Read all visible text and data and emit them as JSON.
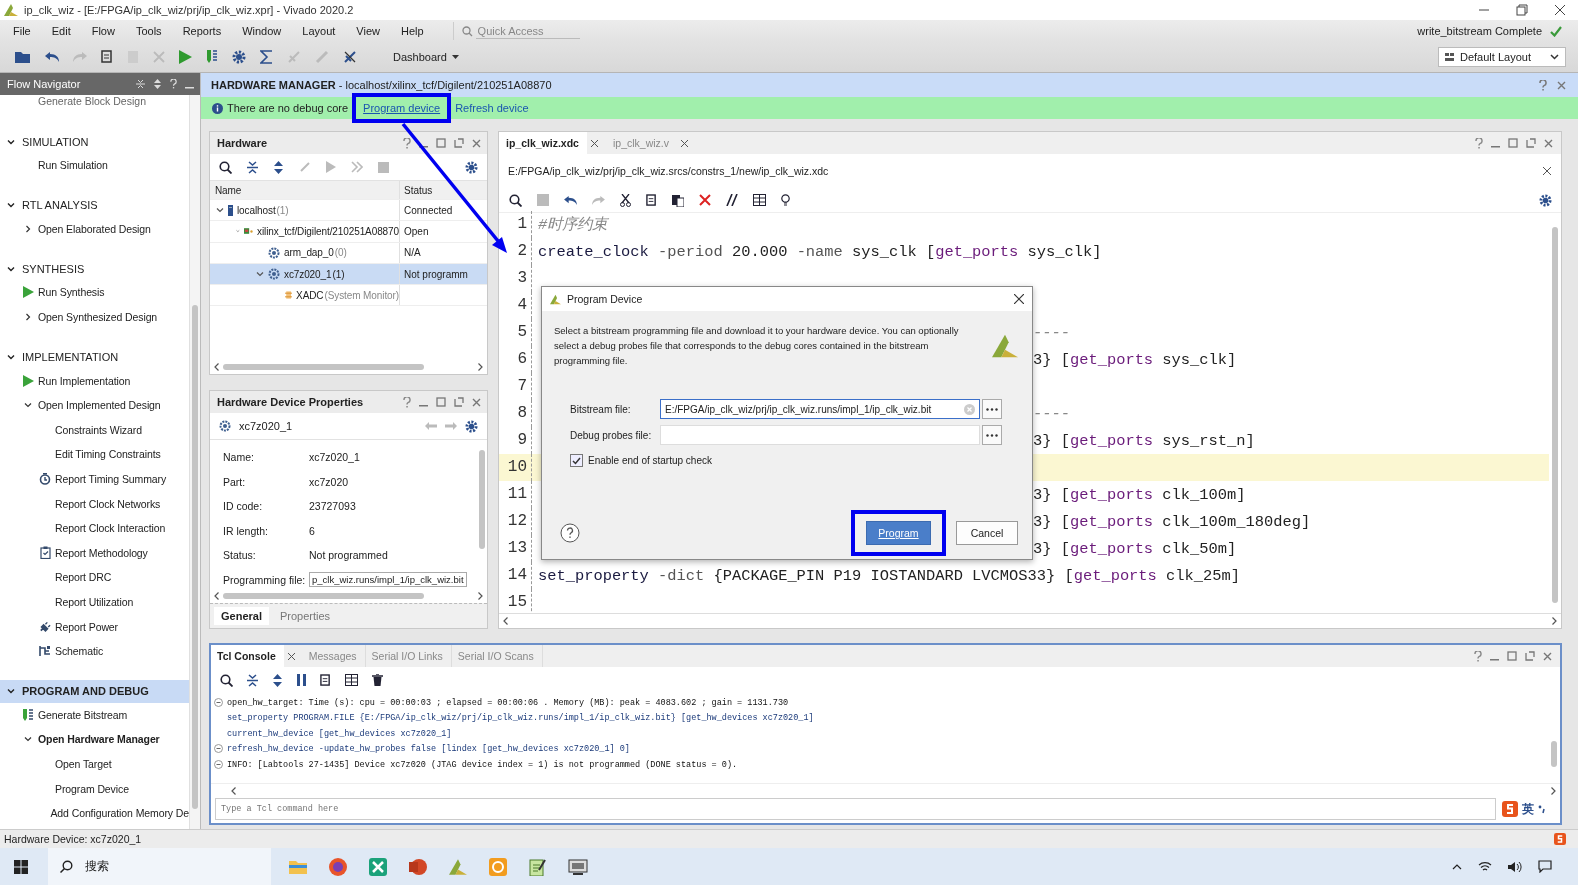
{
  "window": {
    "title": "ip_clk_wiz - [E:/FPGA/ip_clk_wiz/prj/ip_clk_wiz.xpr] - Vivado 2020.2"
  },
  "menu": [
    "File",
    "Edit",
    "Flow",
    "Tools",
    "Reports",
    "Window",
    "Layout",
    "View",
    "Help"
  ],
  "quick_access": {
    "placeholder": "Quick Access"
  },
  "dashboard": "Dashboard",
  "run_status": {
    "text": "write_bitstream Complete",
    "complete": true
  },
  "layout_selector": "Default Layout",
  "flow_navigator": {
    "title": "Flow Navigator",
    "top_item": "Generate Block Design",
    "sections": [
      {
        "label": "SIMULATION",
        "expanded": true,
        "selected": false,
        "items": [
          {
            "label": "Run Simulation",
            "kind": "plain"
          }
        ]
      },
      {
        "label": "RTL ANALYSIS",
        "expanded": true,
        "selected": false,
        "items": [
          {
            "label": "Open Elaborated Design",
            "kind": "plain",
            "expanded": false
          }
        ]
      },
      {
        "label": "SYNTHESIS",
        "expanded": true,
        "selected": false,
        "items": [
          {
            "label": "Run Synthesis",
            "kind": "run"
          },
          {
            "label": "Open Synthesized Design",
            "kind": "plain",
            "expanded": false
          }
        ]
      },
      {
        "label": "IMPLEMENTATION",
        "expanded": true,
        "selected": false,
        "items": [
          {
            "label": "Run Implementation",
            "kind": "run"
          },
          {
            "label": "Open Implemented Design",
            "kind": "plain",
            "expanded": true,
            "children": [
              {
                "label": "Constraints Wizard",
                "kind": "plain"
              },
              {
                "label": "Edit Timing Constraints",
                "kind": "plain"
              },
              {
                "label": "Report Timing Summary",
                "kind": "timing"
              },
              {
                "label": "Report Clock Networks",
                "kind": "plain"
              },
              {
                "label": "Report Clock Interaction",
                "kind": "plain"
              },
              {
                "label": "Report Methodology",
                "kind": "report"
              },
              {
                "label": "Report DRC",
                "kind": "plain"
              },
              {
                "label": "Report Utilization",
                "kind": "plain"
              },
              {
                "label": "Report Power",
                "kind": "power"
              },
              {
                "label": "Schematic",
                "kind": "schematic"
              }
            ]
          }
        ]
      },
      {
        "label": "PROGRAM AND DEBUG",
        "expanded": true,
        "selected": true,
        "items": [
          {
            "label": "Generate Bitstream",
            "kind": "bitstream"
          },
          {
            "label": "Open Hardware Manager",
            "kind": "plain",
            "expanded": true,
            "bold": true,
            "children": [
              {
                "label": "Open Target",
                "kind": "plain"
              },
              {
                "label": "Program Device",
                "kind": "plain"
              },
              {
                "label": "Add Configuration Memory De",
                "kind": "plain"
              }
            ]
          }
        ]
      }
    ]
  },
  "hardware_manager": {
    "title": "HARDWARE MANAGER",
    "path": " - localhost/xilinx_tcf/Digilent/210251A08870",
    "banner": {
      "text": "There are no debug core",
      "links": [
        {
          "label": "Program device",
          "highlighted": true
        },
        {
          "label": "Refresh device",
          "highlighted": false
        }
      ]
    }
  },
  "annotation_arrow": true,
  "hardware": {
    "title": "Hardware",
    "columns": [
      "Name",
      "Status"
    ],
    "tree": [
      {
        "name": "localhost",
        "count": "(1)",
        "status": "Connected",
        "kind": "server",
        "expanded": true,
        "selected": false,
        "children": [
          {
            "name": "xilinx_tcf/Digilent/210251A08870",
            "status": "Open",
            "kind": "cable",
            "expanded": true,
            "selected": false,
            "children": [
              {
                "name": "arm_dap_0",
                "count": "(0)",
                "status": "N/A",
                "kind": "chip",
                "selected": false
              },
              {
                "name": "xc7z020_1",
                "count": "(1)",
                "status": "Not programm",
                "kind": "chip",
                "expanded": true,
                "selected": true,
                "children": [
                  {
                    "name": "XADC",
                    "count": "(System Monitor)",
                    "kind": "monitor",
                    "selected": false
                  }
                ]
              }
            ]
          }
        ]
      }
    ]
  },
  "properties": {
    "title": "Hardware Device Properties",
    "device": "xc7z020_1",
    "rows": [
      {
        "label": "Name:",
        "value": "xc7z020_1",
        "kind": "text"
      },
      {
        "label": "Part:",
        "value": "xc7z020",
        "kind": "text"
      },
      {
        "label": "ID code:",
        "value": "23727093",
        "kind": "text"
      },
      {
        "label": "IR length:",
        "value": "6",
        "kind": "text"
      },
      {
        "label": "Status:",
        "value": "Not programmed",
        "kind": "text"
      },
      {
        "label": "Programming file:",
        "value": "p_clk_wiz.runs/impl_1/ip_clk_wiz.bit",
        "kind": "field"
      }
    ],
    "tabs": [
      {
        "label": "General",
        "selected": true
      },
      {
        "label": "Properties",
        "selected": false
      }
    ]
  },
  "editor": {
    "tabs": [
      {
        "label": "ip_clk_wiz.xdc",
        "selected": true
      },
      {
        "label": "ip_clk_wiz.v",
        "selected": false
      }
    ],
    "path": "E:/FPGA/ip_clk_wiz/prj/ip_clk_wiz.srcs/constrs_1/new/ip_clk_wiz.xdc",
    "lines": [
      {
        "number": "1",
        "current": false,
        "covered": false,
        "tokens": [
          {
            "text": "#时序约束",
            "kind": "comment"
          }
        ]
      },
      {
        "number": "2",
        "current": false,
        "covered": false,
        "tokens": [
          {
            "text": "create_clock",
            "kind": "command"
          },
          {
            "text": " -period ",
            "kind": "option"
          },
          {
            "text": "20.000",
            "kind": "plain"
          },
          {
            "text": " -name ",
            "kind": "option"
          },
          {
            "text": "sys_clk [",
            "kind": "plain"
          },
          {
            "text": "get_ports",
            "kind": "keyword"
          },
          {
            "text": " sys_clk]",
            "kind": "plain"
          }
        ]
      },
      {
        "number": "3",
        "current": false,
        "covered": true
      },
      {
        "number": "4",
        "current": false,
        "covered": true
      },
      {
        "number": "5",
        "current": false,
        "covered": true,
        "tokens": [
          {
            "text": "----",
            "kind": "comment"
          }
        ]
      },
      {
        "number": "6",
        "current": false,
        "covered": true,
        "tokens": [
          {
            "text": "3} [",
            "kind": "plain"
          },
          {
            "text": "get_ports",
            "kind": "keyword"
          },
          {
            "text": " sys_clk]",
            "kind": "plain"
          }
        ]
      },
      {
        "number": "7",
        "current": false,
        "covered": true
      },
      {
        "number": "8",
        "current": false,
        "covered": true,
        "tokens": [
          {
            "text": "----",
            "kind": "comment"
          }
        ]
      },
      {
        "number": "9",
        "current": false,
        "covered": true,
        "tokens": [
          {
            "text": "3} [",
            "kind": "plain"
          },
          {
            "text": "get_ports",
            "kind": "keyword"
          },
          {
            "text": " sys_rst_n]",
            "kind": "plain"
          }
        ]
      },
      {
        "number": "10",
        "current": true,
        "covered": true
      },
      {
        "number": "11",
        "current": false,
        "covered": true,
        "tokens": [
          {
            "text": "3} [",
            "kind": "plain"
          },
          {
            "text": "get_ports",
            "kind": "keyword"
          },
          {
            "text": " clk_100m]",
            "kind": "plain"
          }
        ]
      },
      {
        "number": "12",
        "current": false,
        "covered": true,
        "tokens": [
          {
            "text": "3} [",
            "kind": "plain"
          },
          {
            "text": "get_ports",
            "kind": "keyword"
          },
          {
            "text": " clk_100m_180deg]",
            "kind": "plain"
          }
        ]
      },
      {
        "number": "13",
        "current": false,
        "covered": true,
        "tokens": [
          {
            "text": "3} [",
            "kind": "plain"
          },
          {
            "text": "get_ports",
            "kind": "keyword"
          },
          {
            "text": " clk_50m]",
            "kind": "plain"
          }
        ]
      },
      {
        "number": "14",
        "current": false,
        "covered": false,
        "tokens": [
          {
            "text": "set_property",
            "kind": "command"
          },
          {
            "text": " -dict ",
            "kind": "option"
          },
          {
            "text": "{PACKAGE_PIN P19 IOSTANDARD LVCMOS33} [",
            "kind": "plain"
          },
          {
            "text": "get_ports",
            "kind": "keyword"
          },
          {
            "text": " clk_25m]",
            "kind": "plain"
          }
        ]
      },
      {
        "number": "15",
        "current": false,
        "covered": false
      }
    ]
  },
  "dialog": {
    "title": "Program Device",
    "description": "Select a bitstream programming file and download it to your hardware device. You can optionally select a debug probes file that corresponds to the debug cores contained in the bitstream programming file.",
    "fields": [
      {
        "label": "Bitstream file:",
        "value": "E:/FPGA/ip_clk_wiz/prj/ip_clk_wiz.runs/impl_1/ip_clk_wiz.bit",
        "focused": true,
        "clearable": true
      },
      {
        "label": "Debug probes file:",
        "focused": false,
        "clearable": false
      }
    ],
    "checkbox": {
      "label": "Enable end of startup check",
      "checked": true
    },
    "buttons": [
      {
        "label": "Program",
        "kind": "primary",
        "highlighted": true
      },
      {
        "label": "Cancel",
        "kind": "secondary",
        "highlighted": false
      }
    ]
  },
  "tcl": {
    "tabs": [
      {
        "label": "Tcl Console",
        "selected": true
      },
      {
        "label": "Messages",
        "selected": false
      },
      {
        "label": "Serial I/O Links",
        "selected": false
      },
      {
        "label": "Serial I/O Scans",
        "selected": false
      }
    ],
    "lines": [
      {
        "text": "open_hw_target: Time (s): cpu = 00:00:03 ; elapsed = 00:00:06 . Memory (MB): peak = 4083.602 ; gain = 1131.730",
        "kind": "output",
        "fold": true
      },
      {
        "text": "set_property PROGRAM.FILE {E:/FPGA/ip_clk_wiz/prj/ip_clk_wiz.runs/impl_1/ip_clk_wiz.bit} [get_hw_devices xc7z020_1]",
        "kind": "command",
        "fold": false
      },
      {
        "text": "current_hw_device [get_hw_devices xc7z020_1]",
        "kind": "command",
        "fold": false
      },
      {
        "text": "refresh_hw_device -update_hw_probes false [lindex [get_hw_devices xc7z020_1] 0]",
        "kind": "command",
        "fold": true
      },
      {
        "text": "INFO: [Labtools 27-1435] Device xc7z020 (JTAG device index = 1) is not programmed (DONE status = 0).",
        "kind": "output",
        "fold": true
      }
    ],
    "placeholder": "Type a Tcl command here",
    "ime": "英"
  },
  "status_bar": "Hardware Device: xc7z020_1",
  "taskbar": {
    "search": "搜索"
  }
}
